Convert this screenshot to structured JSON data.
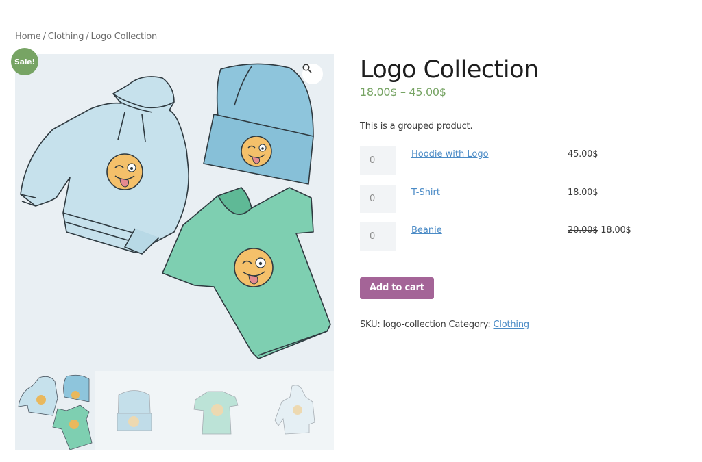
{
  "breadcrumb": {
    "items": [
      {
        "label": "Home",
        "link": true
      },
      {
        "label": "Clothing",
        "link": true
      },
      {
        "label": "Logo Collection",
        "link": false
      }
    ],
    "separator": "/"
  },
  "gallery": {
    "sale_badge": "Sale!",
    "zoom_icon": "magnifier-icon",
    "main_image": "logo-collection-illustration",
    "thumbnails": [
      {
        "name": "logo-collection",
        "active": true
      },
      {
        "name": "beanie",
        "active": false
      },
      {
        "name": "t-shirt",
        "active": false
      },
      {
        "name": "hoodie",
        "active": false
      }
    ]
  },
  "product": {
    "title": "Logo Collection",
    "price_range": "18.00$ – 45.00$",
    "short_description": "This is a grouped product.",
    "grouped_items": [
      {
        "qty": "0",
        "name": "Hoodie with Logo",
        "price": "45.00$",
        "regular_price": ""
      },
      {
        "qty": "0",
        "name": "T-Shirt",
        "price": "18.00$",
        "regular_price": ""
      },
      {
        "qty": "0",
        "name": "Beanie",
        "price": "18.00$",
        "regular_price": "20.00$"
      }
    ],
    "add_to_cart_label": "Add to cart",
    "sku_label": "SKU:",
    "sku": "logo-collection",
    "category_label": "Category:",
    "category": "Clothing"
  },
  "colors": {
    "sale": "#77a464",
    "price": "#77a464",
    "button": "#a46497",
    "link": "#4b8bc6"
  }
}
